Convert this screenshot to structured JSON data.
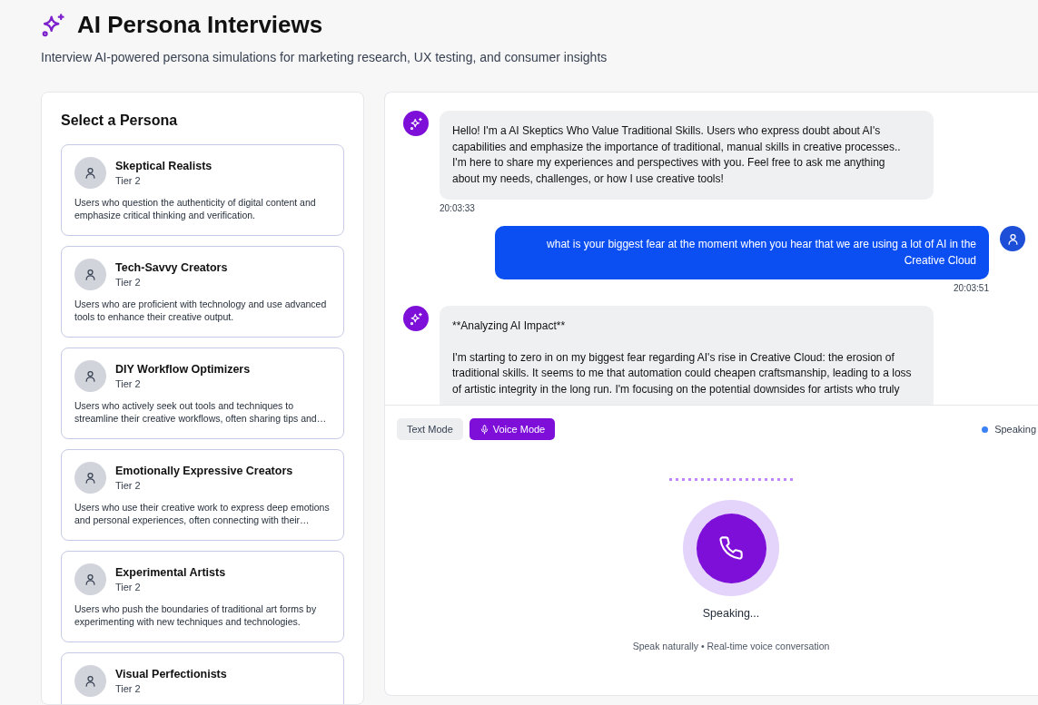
{
  "header": {
    "title": "AI Persona Interviews",
    "subtitle": "Interview AI-powered persona simulations for marketing research, UX testing, and consumer insights"
  },
  "persona_panel": {
    "title": "Select a Persona",
    "personas": [
      {
        "name": "Skeptical Realists",
        "tier": "Tier 2",
        "description": "Users who question the authenticity of digital content and emphasize critical thinking and verification."
      },
      {
        "name": "Tech-Savvy Creators",
        "tier": "Tier 2",
        "description": "Users who are proficient with technology and use advanced tools to enhance their creative output."
      },
      {
        "name": "DIY Workflow Optimizers",
        "tier": "Tier 2",
        "description": "Users who actively seek out tools and techniques to streamline their creative workflows, often sharing tips and…"
      },
      {
        "name": "Emotionally Expressive Creators",
        "tier": "Tier 2",
        "description": "Users who use their creative work to express deep emotions and personal experiences, often connecting with their…"
      },
      {
        "name": "Experimental Artists",
        "tier": "Tier 2",
        "description": "Users who push the boundaries of traditional art forms by experimenting with new techniques and technologies."
      },
      {
        "name": "Visual Perfectionists",
        "tier": "Tier 2"
      }
    ]
  },
  "chat": {
    "messages": [
      {
        "kind": "assistant",
        "paragraphs": [
          "Hello! I'm a AI Skeptics Who Value Traditional Skills. Users who express doubt about AI's capabilities and emphasize the importance of traditional, manual skills in creative processes.. I'm here to share my experiences and perspectives with you. Feel free to ask me anything about my needs, challenges, or how I use creative tools!"
        ],
        "time": "20:03:33"
      },
      {
        "kind": "user",
        "paragraphs": [
          "what is your biggest fear at the moment when you hear that we are using a lot of AI in the Creative Cloud"
        ],
        "time": "20:03:51"
      },
      {
        "kind": "assistant",
        "paragraphs": [
          "**Analyzing AI Impact**",
          "I'm starting to zero in on my biggest fear regarding AI's rise in Creative Cloud: the erosion of traditional skills. It seems to me that automation could cheapen craftsmanship, leading to a loss of artistic integrity in the long run. I'm focusing on the potential downsides for artists who truly"
        ]
      }
    ]
  },
  "modes": [
    {
      "label": "Text Mode",
      "selected": false
    },
    {
      "label": "Voice Mode",
      "selected": true
    }
  ],
  "voice": {
    "status": "Speaking",
    "caption": "Speaking...",
    "hint": "Speak naturally • Real-time voice conversation"
  }
}
